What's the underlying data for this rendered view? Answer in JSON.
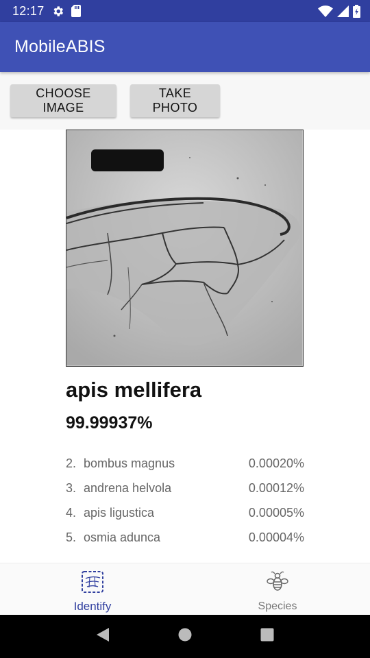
{
  "status_bar": {
    "time": "12:17",
    "icons": [
      "settings-gear-icon",
      "sd-card-icon",
      "wifi-icon",
      "cell-signal-icon",
      "battery-icon"
    ]
  },
  "app_bar": {
    "title": "MobileABIS"
  },
  "toolbar": {
    "choose_image_label": "CHOOSE IMAGE",
    "take_photo_label": "TAKE PHOTO"
  },
  "result": {
    "image_description": "Grayscale microscope image of a bee wing with vein pattern",
    "top_species": "apis mellifera",
    "top_probability": "99.99937%",
    "others": [
      {
        "rank": "2.",
        "name": "bombus magnus",
        "prob": "0.00020%"
      },
      {
        "rank": "3.",
        "name": "andrena helvola",
        "prob": "0.00012%"
      },
      {
        "rank": "4.",
        "name": "apis ligustica",
        "prob": "0.00005%"
      },
      {
        "rank": "5.",
        "name": "osmia adunca",
        "prob": "0.00004%"
      }
    ]
  },
  "bottom_nav": {
    "items": [
      {
        "label": "Identify",
        "icon": "wing-scan-icon",
        "active": true
      },
      {
        "label": "Species",
        "icon": "bee-icon",
        "active": false
      }
    ]
  },
  "system_nav": {
    "icons": [
      "back-icon",
      "home-icon",
      "recents-icon"
    ]
  },
  "colors": {
    "primary": "#3f51b5",
    "primary_dark": "#303f9f",
    "button_bg": "#d6d6d6",
    "active_nav": "#303f9f",
    "inactive_nav": "#777777"
  }
}
